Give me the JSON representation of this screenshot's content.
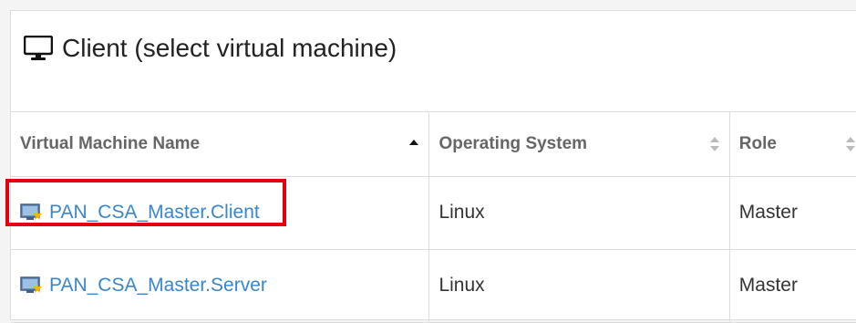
{
  "panel": {
    "title": "Client (select virtual machine)",
    "icon": "monitor-icon"
  },
  "table": {
    "columns": [
      {
        "label": "Virtual Machine Name",
        "sort": "ascending"
      },
      {
        "label": "Operating System",
        "sort": "none"
      },
      {
        "label": "Role",
        "sort": "none"
      }
    ],
    "rows": [
      {
        "name": "PAN_CSA_Master.Client",
        "os": "Linux",
        "role": "Master",
        "icon": "vm-icon",
        "highlighted": true
      },
      {
        "name": "PAN_CSA_Master.Server",
        "os": "Linux",
        "role": "Master",
        "icon": "vm-icon",
        "highlighted": false
      }
    ]
  },
  "colors": {
    "link": "#3a86c8",
    "highlight": "#e3000f"
  }
}
